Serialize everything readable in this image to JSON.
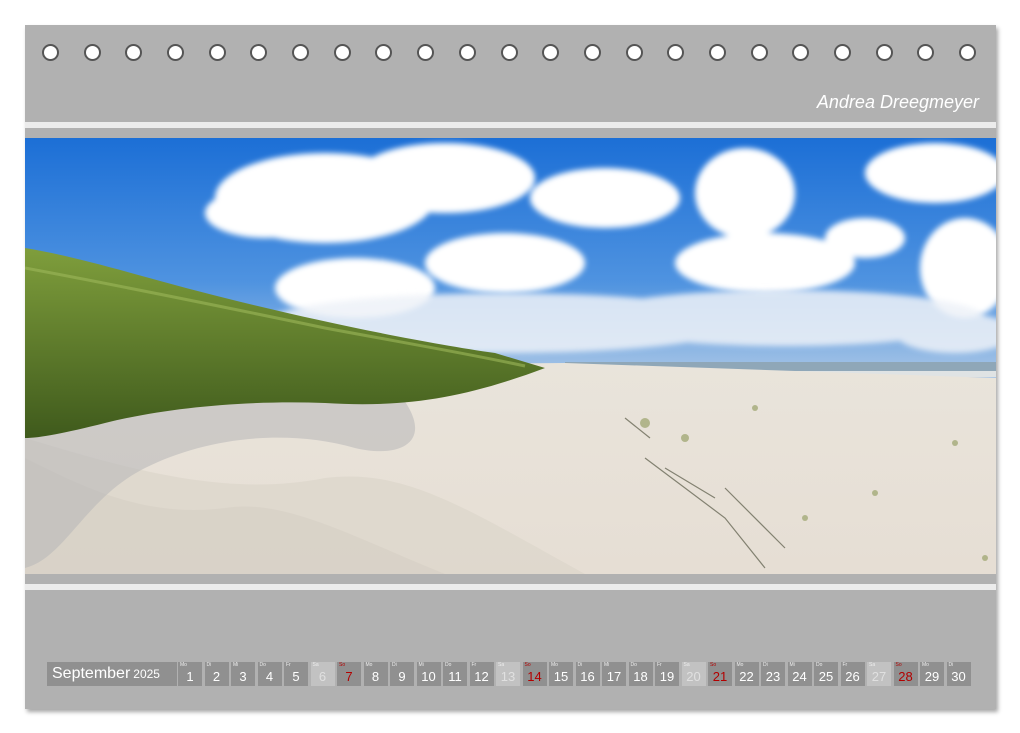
{
  "calendar": {
    "author": "Andrea Dreegmeyer",
    "photo": {
      "subject": "beach-dunes-photo"
    },
    "month": "September",
    "year": "2025",
    "days": [
      {
        "n": "1",
        "w": "Mo",
        "t": "weekday"
      },
      {
        "n": "2",
        "w": "Di",
        "t": "weekday"
      },
      {
        "n": "3",
        "w": "Mi",
        "t": "weekday"
      },
      {
        "n": "4",
        "w": "Do",
        "t": "weekday"
      },
      {
        "n": "5",
        "w": "Fr",
        "t": "weekday"
      },
      {
        "n": "6",
        "w": "Sa",
        "t": "sat"
      },
      {
        "n": "7",
        "w": "So",
        "t": "sun"
      },
      {
        "n": "8",
        "w": "Mo",
        "t": "weekday"
      },
      {
        "n": "9",
        "w": "Di",
        "t": "weekday"
      },
      {
        "n": "10",
        "w": "Mi",
        "t": "weekday"
      },
      {
        "n": "11",
        "w": "Do",
        "t": "weekday"
      },
      {
        "n": "12",
        "w": "Fr",
        "t": "weekday"
      },
      {
        "n": "13",
        "w": "Sa",
        "t": "sat"
      },
      {
        "n": "14",
        "w": "So",
        "t": "sun"
      },
      {
        "n": "15",
        "w": "Mo",
        "t": "weekday"
      },
      {
        "n": "16",
        "w": "Di",
        "t": "weekday"
      },
      {
        "n": "17",
        "w": "Mi",
        "t": "weekday"
      },
      {
        "n": "18",
        "w": "Do",
        "t": "weekday"
      },
      {
        "n": "19",
        "w": "Fr",
        "t": "weekday"
      },
      {
        "n": "20",
        "w": "Sa",
        "t": "sat"
      },
      {
        "n": "21",
        "w": "So",
        "t": "sun"
      },
      {
        "n": "22",
        "w": "Mo",
        "t": "weekday"
      },
      {
        "n": "23",
        "w": "Di",
        "t": "weekday"
      },
      {
        "n": "24",
        "w": "Mi",
        "t": "weekday"
      },
      {
        "n": "25",
        "w": "Do",
        "t": "weekday"
      },
      {
        "n": "26",
        "w": "Fr",
        "t": "weekday"
      },
      {
        "n": "27",
        "w": "Sa",
        "t": "sat"
      },
      {
        "n": "28",
        "w": "So",
        "t": "sun"
      },
      {
        "n": "29",
        "w": "Mo",
        "t": "weekday"
      },
      {
        "n": "30",
        "w": "Di",
        "t": "weekday"
      }
    ],
    "colors": {
      "frame": "#b1b1b1",
      "cell": "#909090",
      "saturday": "#c2c2c2",
      "sunday_text": "#b30000"
    }
  }
}
